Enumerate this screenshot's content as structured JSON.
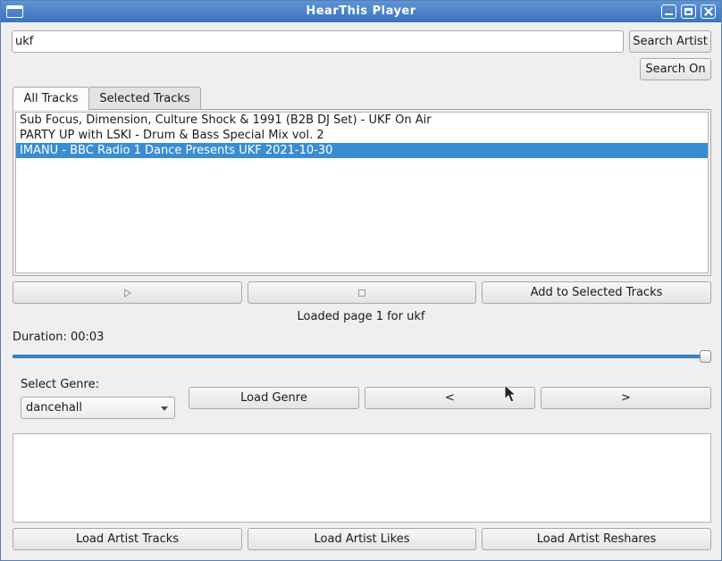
{
  "window": {
    "title": "HearThis Player"
  },
  "search": {
    "value": "ukf",
    "search_artist_label": "Search Artist",
    "search_on_label": "Search On"
  },
  "tabs": [
    {
      "label": "All Tracks",
      "active": true
    },
    {
      "label": "Selected Tracks",
      "active": false
    }
  ],
  "tracks": [
    {
      "label": "Sub Focus, Dimension, Culture Shock & 1991 (B2B DJ Set) - UKF On Air",
      "selected": false
    },
    {
      "label": "PARTY UP with LSKI - Drum & Bass Special Mix vol. 2",
      "selected": false
    },
    {
      "label": "IMANU - BBC Radio 1 Dance Presents UKF 2021-10-30",
      "selected": true
    }
  ],
  "controls": {
    "play_icon": "play-icon",
    "stop_icon": "stop-icon",
    "add_label": "Add to Selected Tracks"
  },
  "status": {
    "text": "Loaded page 1 for ukf"
  },
  "duration": {
    "text": "Duration: 00:03",
    "progress_fraction": 1.0
  },
  "genre": {
    "label": "Select Genre:",
    "selected": "dancehall",
    "load_label": "Load Genre",
    "prev_label": "<",
    "next_label": ">"
  },
  "bottom": {
    "artist_tracks_label": "Load Artist Tracks",
    "artist_likes_label": "Load Artist Likes",
    "artist_reshares_label": "Load Artist Reshares"
  },
  "colors": {
    "titlebar": "#3b73bd",
    "selection": "#3a8dd0"
  }
}
